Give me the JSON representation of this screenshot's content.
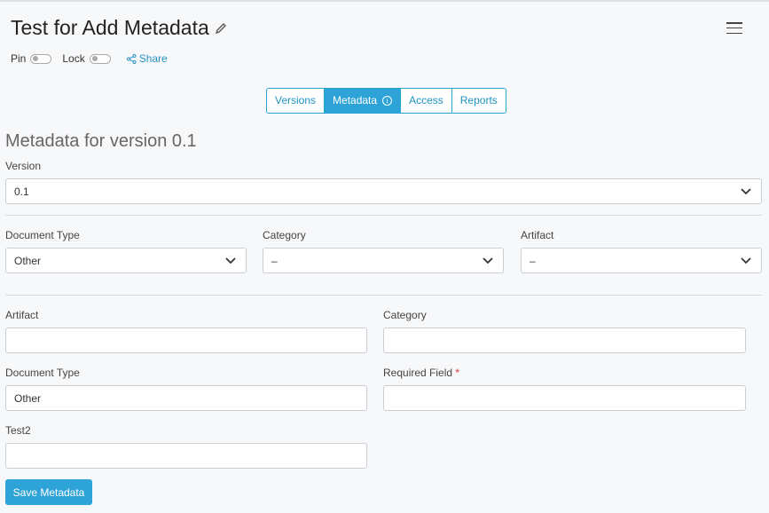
{
  "header": {
    "title": "Test for Add Metadata",
    "pin_label": "Pin",
    "lock_label": "Lock",
    "share_label": "Share"
  },
  "tabs": [
    {
      "label": "Versions",
      "active": false
    },
    {
      "label": "Metadata",
      "active": true
    },
    {
      "label": "Access",
      "active": false
    },
    {
      "label": "Reports",
      "active": false
    }
  ],
  "section_title": "Metadata for version 0.1",
  "version": {
    "label": "Version",
    "value": "0.1"
  },
  "filters": {
    "document_type": {
      "label": "Document Type",
      "value": "Other"
    },
    "category": {
      "label": "Category",
      "value": "–"
    },
    "artifact": {
      "label": "Artifact",
      "value": "–"
    }
  },
  "fields": {
    "artifact": {
      "label": "Artifact",
      "value": ""
    },
    "category": {
      "label": "Category",
      "value": ""
    },
    "document_type": {
      "label": "Document Type",
      "value": "Other"
    },
    "required_field": {
      "label": "Required Field",
      "required_marker": "*",
      "value": ""
    },
    "test2": {
      "label": "Test2",
      "value": ""
    }
  },
  "save_button": "Save Metadata",
  "colors": {
    "accent": "#2ea3d8",
    "required": "#dd3333"
  },
  "icons": [
    "pencil-icon",
    "menu-icon",
    "share-icon",
    "info-icon",
    "chevron-down-icon"
  ]
}
